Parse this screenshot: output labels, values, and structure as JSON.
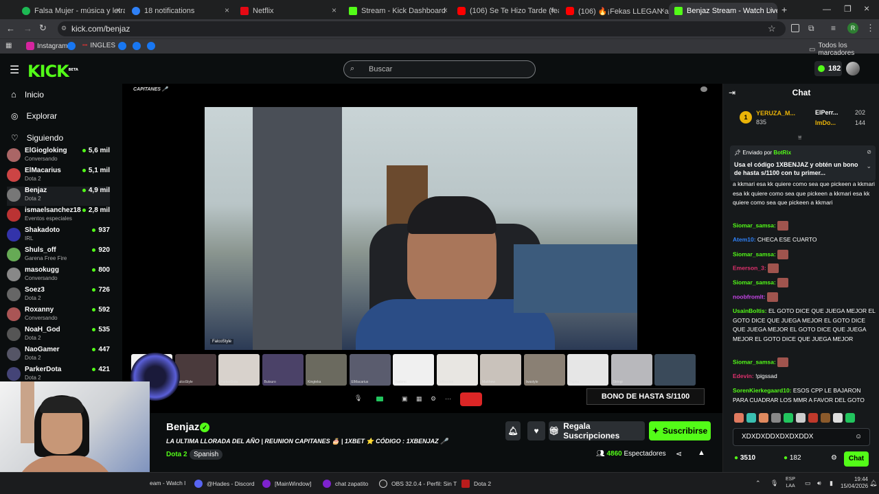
{
  "browser": {
    "tabs": [
      {
        "label": "Falsa Mujer - música y letra de",
        "color": "#1db954"
      },
      {
        "label": "18 notifications",
        "color": "#2f81f7"
      },
      {
        "label": "Netflix",
        "color": "#e50914"
      },
      {
        "label": "Stream - Kick Dashboard",
        "color": "#53fc18"
      },
      {
        "label": "(106) Se Te Hizo Tarde (feat. El",
        "color": "#ff0000"
      },
      {
        "label": "(106) 🔥¡Fekas LLEGAN a Colo",
        "color": "#ff0000"
      },
      {
        "label": "Benjaz Stream - Watch Live",
        "color": "#53fc18"
      }
    ],
    "url": "kick.com/benjaz",
    "bookmarks": [
      "Instagram",
      "INGLES"
    ],
    "all_bookmarks": "Todos los marcadores",
    "profile_initial": "R"
  },
  "kick": {
    "logo": "KICK",
    "logo_badge": "BETA",
    "search_placeholder": "Buscar",
    "points": "182"
  },
  "nav": {
    "home": "Inicio",
    "explore": "Explorar",
    "following": "Siguiendo"
  },
  "channels": [
    {
      "name": "ElGiogloking",
      "game": "Conversando",
      "viewers": "5,6 mil"
    },
    {
      "name": "ElMacarius",
      "game": "Dota 2",
      "viewers": "5,1 mil"
    },
    {
      "name": "Benjaz",
      "game": "Dota 2",
      "viewers": "4,9 mil"
    },
    {
      "name": "ismaelsanchez18",
      "game": "Eventos especiales",
      "viewers": "2,8 mil"
    },
    {
      "name": "Shakadoto",
      "game": "IRL",
      "viewers": "937"
    },
    {
      "name": "Shuls_off",
      "game": "Garena Free Fire",
      "viewers": "920"
    },
    {
      "name": "masokugg",
      "game": "Conversando",
      "viewers": "800"
    },
    {
      "name": "Soez3",
      "game": "Dota 2",
      "viewers": "726"
    },
    {
      "name": "Roxanny",
      "game": "Conversando",
      "viewers": "592"
    },
    {
      "name": "NoaH_God",
      "game": "Dota 2",
      "viewers": "535"
    },
    {
      "name": "NaoGamer",
      "game": "Dota 2",
      "viewers": "447"
    },
    {
      "name": "ParkerDota",
      "game": "Dota 2",
      "viewers": "421"
    }
  ],
  "stream": {
    "overlay_label": "CAPITANES 🎤",
    "cam_label": "FalcoStyle",
    "thumbs": [
      "",
      "FalcoStyle",
      "ParkerDota",
      "Butsuro",
      "Kingteka",
      "ElMacarius",
      "Yadomi",
      "Jeffrectos",
      "Matthew",
      "Iwastyle",
      "Papita",
      "Stringi",
      ""
    ],
    "bono": "BONO DE HASTA S/1100",
    "streamer": "Benjaz",
    "title": "LA ULTIMA LLORADA DEL AÑO | REUNION CAPITANES 🎂 | 1XBET ⭐ CÓDIGO : 1XBENJAZ 🎤",
    "category": "Dota 2",
    "language": "Spanish",
    "gift_button": "Regala Suscripciones",
    "subscribe_button": "Suscribirse",
    "viewers": "4860",
    "viewers_label": "Espectadores"
  },
  "chat": {
    "title": "Chat",
    "leaders": [
      {
        "name": "YERUZA_M...",
        "value": "835"
      },
      {
        "name": "ElPerr...",
        "value": "202"
      },
      {
        "name": "ImDo...",
        "value": "144"
      }
    ],
    "pinned_by": "Enviado por",
    "pinned_user": "BotRix",
    "pinned_text": "Usa el código 1XBENJAZ y obtén un bono de hasta s/1100 con tu primer...",
    "messages": [
      {
        "user": "",
        "text": "a kkmari [emo] esa kk quiere como sea que pickeen a kkmari [emo] esa kk quiere como sea que pickeen a kkmari [emo] esa kk quiere como sea que pickeen a kkmari",
        "color": "#ffffff"
      },
      {
        "user": "Siomar_samsa:",
        "text": "",
        "color": "#53fc18"
      },
      {
        "user": "Atem10:",
        "text": "CHECA ESE CUARTO",
        "color": "#2f81f7"
      },
      {
        "user": "Siomar_samsa:",
        "text": "",
        "color": "#53fc18"
      },
      {
        "user": "Emerson_3:",
        "text": "",
        "color": "#e0306d"
      },
      {
        "user": "Siomar_samsa:",
        "text": "",
        "color": "#53fc18"
      },
      {
        "user": "noobfromlt:",
        "text": "",
        "color": "#c545e6"
      },
      {
        "user": "UsainBoltis:",
        "text": "EL GOTO DICE QUE JUEGA MEJOR EL GOTO DICE QUE JUEGA MEJOR EL GOTO DICE QUE JUEGA MEJOR EL GOTO DICE QUE JUEGA MEJOR EL GOTO DICE QUE JUEGA MEJOR",
        "color": "#53fc18"
      },
      {
        "user": "Siomar_samsa:",
        "text": "",
        "color": "#53fc18"
      },
      {
        "user": "Edevin:",
        "text": "!pigssad",
        "color": "#e0306d"
      },
      {
        "user": "SorenKierkegaard10:",
        "text": "ESOS CPP LE BAJARON PARA CUADRAR LOS MMR A FAVOR DEL GOTO",
        "color": "#53fc18"
      }
    ],
    "input_value": "XDXDXDDXDXDXDDX",
    "kick_points": "3510",
    "sub_count": "182",
    "send": "Chat"
  },
  "taskbar": {
    "items": [
      "eam - Watch l",
      "@Hades - Discord",
      "[MainWindow]",
      "chat zapatito",
      "OBS 32.0.4 - Perfil: Sin T",
      "Dota 2"
    ],
    "lang": "ESP",
    "lang2": "LAA",
    "time": "19:44",
    "date": "15/04/2026"
  }
}
